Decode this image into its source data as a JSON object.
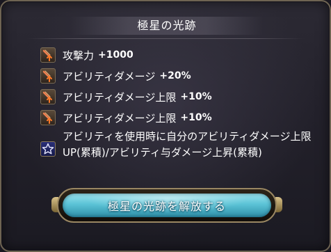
{
  "panel": {
    "title": "極星の光跡"
  },
  "effects": [
    {
      "icon": "sword-up-icon",
      "label": "攻撃力",
      "value": "+1000"
    },
    {
      "icon": "sword-up-icon",
      "label": "アビリティダメージ",
      "value": "+20%"
    },
    {
      "icon": "sword-up-icon",
      "label": "アビリティダメージ上限",
      "value": "+10%"
    },
    {
      "icon": "sword-up-icon",
      "label": "アビリティダメージ上限",
      "value": "+10%"
    }
  ],
  "special_effect": {
    "icon": "star-icon",
    "text": "アビリティを使用時に自分のアビリティダメージ上限UP(累積)/アビリティ与ダメージ上昇(累積)"
  },
  "action_button": {
    "label": "極星の光跡を解放する"
  },
  "colors": {
    "text": "#ffffff",
    "button_gradient_top": "#9ce4ee",
    "button_gradient_bottom": "#2f8fa8",
    "frame": "#6e6452",
    "star_icon_bg": "#2a2f78"
  }
}
